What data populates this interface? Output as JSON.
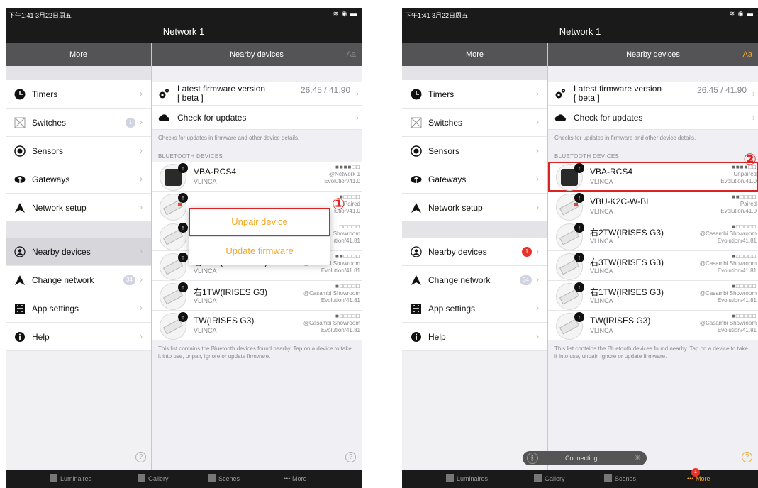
{
  "left": {
    "status": {
      "time": "下午1:41  3月22日周五",
      "icons": "≋ ◉ ▬"
    },
    "title": "Network 1",
    "side": {
      "header": "More",
      "items": [
        {
          "label": "Timers",
          "icon": "clock-icon"
        },
        {
          "label": "Switches",
          "icon": "switch-icon",
          "badge": "1"
        },
        {
          "label": "Sensors",
          "icon": "sensor-icon"
        },
        {
          "label": "Gateways",
          "icon": "cloud-upload-icon"
        },
        {
          "label": "Network setup",
          "icon": "navigation-icon"
        }
      ],
      "items2": [
        {
          "label": "Nearby devices",
          "icon": "nearby-icon"
        },
        {
          "label": "Change network",
          "icon": "navigation-icon",
          "badge": "34"
        },
        {
          "label": "App settings",
          "icon": "app-settings-icon"
        },
        {
          "label": "Help",
          "icon": "info-icon"
        }
      ]
    },
    "main": {
      "header": "Nearby devices",
      "aa": "Aa",
      "firmware": {
        "label": "Latest firmware version",
        "sub": "[ beta ]",
        "value": "26.45 / 41.90"
      },
      "check": "Check for updates",
      "note": "Checks for updates in firmware and other device details.",
      "section": "BLUETOOTH DEVICES",
      "devices": [
        {
          "name": "VBA-RCS4",
          "sub": "VLINCA",
          "bars": "■■■■□□",
          "m1": "@Network 1",
          "m2": "Evolution/41.0"
        },
        {
          "name": "",
          "sub": "",
          "bars": "■□□□□",
          "m1": "Paired",
          "m2": "lution/41.0"
        },
        {
          "name": "",
          "sub": "",
          "bars": "□□□□□",
          "m1": "Showroom",
          "m2": "ıtion/41.81"
        },
        {
          "name": "右3TW(IRISES G3)",
          "sub": "VLINCA",
          "bars": "■■□□□□",
          "m1": "@Casambi Showroom",
          "m2": "Evolution/41.81"
        },
        {
          "name": "右1TW(IRISES G3)",
          "sub": "VLINCA",
          "bars": "■□□□□□",
          "m1": "@Casambi Showroom",
          "m2": "Evolution/41.81"
        },
        {
          "name": "TW(IRISES G3)",
          "sub": "VLINCA",
          "bars": "■□□□□□",
          "m1": "@Casambi Showroom",
          "m2": "Evolution/41.81"
        }
      ],
      "popup": {
        "unpair": "Unpair device",
        "update": "Update firmware"
      },
      "marker": "①",
      "footer": "This list contains the Bluetooth devices found nearby. Tap on a device to take it into use, unpair, ignore or update firmware.",
      "help": "?"
    },
    "tabs": [
      "Luminaires",
      "Gallery",
      "Scenes",
      "More"
    ]
  },
  "right": {
    "status": {
      "time": "下午1:41  3月22日周五",
      "icons": "≋ ◉ ▬"
    },
    "title": "Network 1",
    "side": {
      "header": "More",
      "items": [
        {
          "label": "Timers",
          "icon": "clock-icon"
        },
        {
          "label": "Switches",
          "icon": "switch-icon"
        },
        {
          "label": "Sensors",
          "icon": "sensor-icon"
        },
        {
          "label": "Gateways",
          "icon": "cloud-upload-icon"
        },
        {
          "label": "Network setup",
          "icon": "navigation-icon"
        }
      ],
      "items2": [
        {
          "label": "Nearby devices",
          "icon": "nearby-icon",
          "badge": "1"
        },
        {
          "label": "Change network",
          "icon": "navigation-icon",
          "badge": "34"
        },
        {
          "label": "App settings",
          "icon": "app-settings-icon"
        },
        {
          "label": "Help",
          "icon": "info-icon"
        }
      ]
    },
    "main": {
      "header": "Nearby devices",
      "aa": "Aa",
      "firmware": {
        "label": "Latest firmware version",
        "sub": "[ beta ]",
        "value": "26.45 / 41.90"
      },
      "check": "Check for updates",
      "note": "Checks for updates in firmware and other device details.",
      "section": "BLUETOOTH DEVICES",
      "devices": [
        {
          "name": "VBA-RCS4",
          "sub": "VLINCA",
          "bars": "■■■■□□",
          "m1": "Unpaired",
          "m2": "Evolution/41.0"
        },
        {
          "name": "VBU-K2C-W-BI",
          "sub": "VLINCA",
          "bars": "■■□□□□",
          "m1": "Paired",
          "m2": "Evolution/41.0"
        },
        {
          "name": "右2TW(IRISES G3)",
          "sub": "VLINCA",
          "bars": "■□□□□□",
          "m1": "@Casambi Showroom",
          "m2": "Evolution/41.81"
        },
        {
          "name": "右3TW(IRISES G3)",
          "sub": "VLINCA",
          "bars": "■□□□□□",
          "m1": "@Casambi Showroom",
          "m2": "Evolution/41.81"
        },
        {
          "name": "右1TW(IRISES G3)",
          "sub": "VLINCA",
          "bars": "■□□□□□",
          "m1": "@Casambi Showroom",
          "m2": "Evolution/41.81"
        },
        {
          "name": "TW(IRISES G3)",
          "sub": "VLINCA",
          "bars": "■□□□□□",
          "m1": "@Casambi Showroom",
          "m2": "Evolution/41.81"
        }
      ],
      "marker": "②",
      "footer": "This list contains the Bluetooth devices found nearby. Tap on a device to take it into use, unpair, ignore or update firmware.",
      "help": "?",
      "toast": "Connecting..."
    },
    "tabs": [
      "Luminaires",
      "Gallery",
      "Scenes",
      "More"
    ],
    "tab_badge": "1"
  }
}
